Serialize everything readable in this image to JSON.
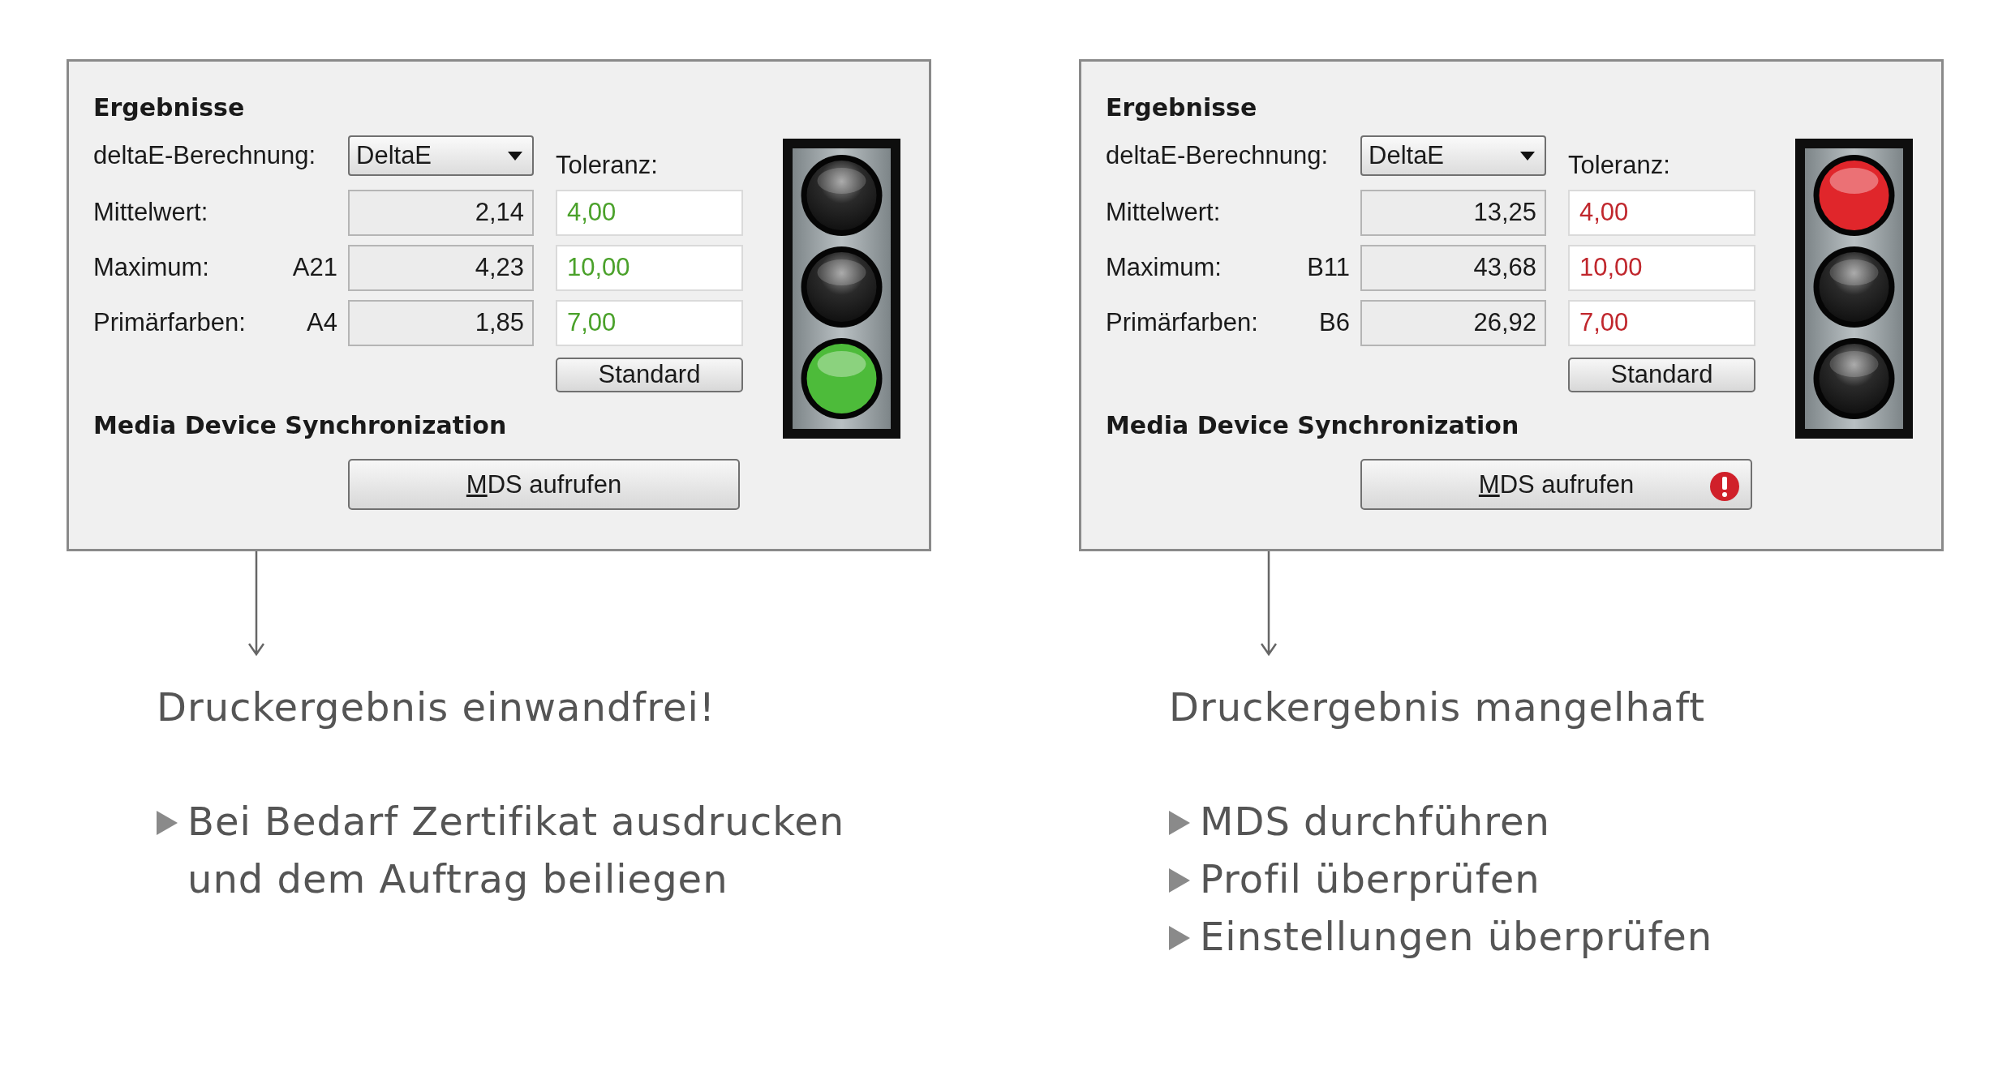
{
  "panels": [
    {
      "heading": "Ergebnisse",
      "calc_label": "deltaE-Berechnung:",
      "calc_value": "DeltaE",
      "tolerance_label": "Toleranz:",
      "tolerance_ok": true,
      "rows": [
        {
          "label": "Mittelwert:",
          "value": "2,14",
          "tolerance": "4,00"
        },
        {
          "label": "Maximum:",
          "site": "A21",
          "value": "4,23",
          "tolerance": "10,00"
        },
        {
          "label": "Primärfarben:",
          "site": "A4",
          "value": "1,85",
          "tolerance": "7,00"
        }
      ],
      "default_button": "Standard",
      "lamps": [
        {
          "on": false
        },
        {
          "on": false
        },
        {
          "on": true
        }
      ],
      "sync_heading": "Media Device Synchronization",
      "sync_button": {
        "label": "MDS aufrufen",
        "warning": false
      },
      "result": {
        "title": "Druckergebnis einwandfrei!",
        "steps": [
          "Bei Bedarf Zertifikat ausdrucken und dem Auftrag beiliegen"
        ]
      }
    },
    {
      "heading": "Ergebnisse",
      "calc_label": "deltaE-Berechnung:",
      "calc_value": "DeltaE",
      "tolerance_label": "Toleranz:",
      "tolerance_ok": false,
      "rows": [
        {
          "label": "Mittelwert:",
          "value": "13,25",
          "tolerance": "4,00"
        },
        {
          "label": "Maximum:",
          "site": "B11",
          "value": "43,68",
          "tolerance": "10,00"
        },
        {
          "label": "Primärfarben:",
          "site": "B6",
          "value": "26,92",
          "tolerance": "7,00"
        }
      ],
      "default_button": "Standard",
      "lamps": [
        {
          "on": true
        },
        {
          "on": false
        },
        {
          "on": false
        }
      ],
      "sync_heading": "Media Device Synchronization",
      "sync_button": {
        "label": "MDS aufrufen",
        "warning": true
      },
      "result": {
        "title": "Druckergebnis mangelhaft",
        "steps": [
          "MDS durchführen",
          "Profil überprüfen",
          "Einstellungen überprüfen"
        ]
      }
    }
  ]
}
